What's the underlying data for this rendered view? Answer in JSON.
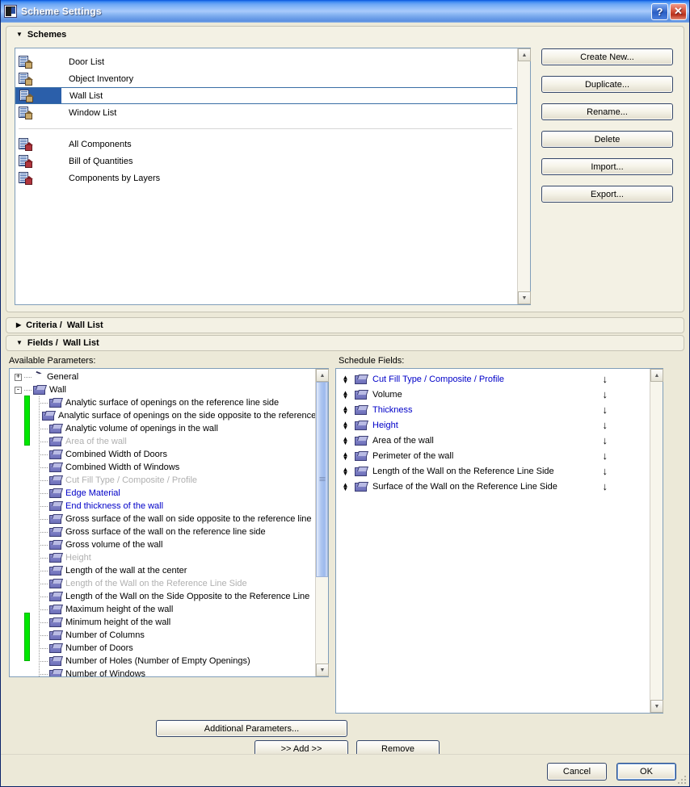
{
  "window": {
    "title": "Scheme Settings",
    "icon": "app-icon",
    "help_button": "?",
    "close_button": "✕"
  },
  "schemes_section": {
    "header": "Schemes",
    "expanded": true,
    "list": {
      "group_a": [
        {
          "label": "Door List",
          "icon": "scheme-icon",
          "selected": false
        },
        {
          "label": "Object Inventory",
          "icon": "scheme-icon",
          "selected": false
        },
        {
          "label": "Wall List",
          "icon": "scheme-icon",
          "selected": true
        },
        {
          "label": "Window List",
          "icon": "scheme-icon",
          "selected": false
        }
      ],
      "group_b": [
        {
          "label": "All Components",
          "icon": "component-scheme-icon",
          "selected": false
        },
        {
          "label": "Bill of Quantities",
          "icon": "component-scheme-icon",
          "selected": false
        },
        {
          "label": "Components by Layers",
          "icon": "component-scheme-icon",
          "selected": false
        }
      ]
    },
    "buttons": [
      {
        "label": "Create New...",
        "name": "create-new-button"
      },
      {
        "label": "Duplicate...",
        "name": "duplicate-button"
      },
      {
        "label": "Rename...",
        "name": "rename-button"
      },
      {
        "label": "Delete",
        "name": "delete-button"
      },
      {
        "label": "Import...",
        "name": "import-button"
      },
      {
        "label": "Export...",
        "name": "export-button"
      }
    ]
  },
  "criteria_section": {
    "header_prefix": "Criteria /",
    "header_suffix": "Wall List",
    "expanded": false
  },
  "fields_section": {
    "header_prefix": "Fields /",
    "header_suffix": "Wall List",
    "expanded": true,
    "available_label": "Available Parameters:",
    "schedule_label": "Schedule Fields:",
    "tree": [
      {
        "label": "General",
        "level": 0,
        "node": true,
        "expander": "+",
        "icon": "cursor-icon",
        "style": "normal"
      },
      {
        "label": "Wall",
        "level": 0,
        "node": true,
        "expander": "-",
        "icon": "folder-icon",
        "style": "normal"
      },
      {
        "label": "Analytic surface of openings on the reference line side",
        "level": 2,
        "icon": "folder-icon",
        "style": "normal"
      },
      {
        "label": "Analytic surface of openings on the side opposite to the reference line",
        "level": 2,
        "icon": "folder-icon",
        "style": "normal"
      },
      {
        "label": "Analytic volume of openings in the wall",
        "level": 2,
        "icon": "folder-icon",
        "style": "normal"
      },
      {
        "label": "Area of the wall",
        "level": 2,
        "icon": "folder-icon",
        "style": "gray"
      },
      {
        "label": "Combined Width of Doors",
        "level": 2,
        "icon": "folder-icon",
        "style": "normal"
      },
      {
        "label": "Combined Width of Windows",
        "level": 2,
        "icon": "folder-icon",
        "style": "normal"
      },
      {
        "label": "Cut Fill Type / Composite / Profile",
        "level": 2,
        "icon": "folder-icon",
        "style": "gray"
      },
      {
        "label": "Edge Material",
        "level": 2,
        "icon": "folder-icon",
        "style": "blue"
      },
      {
        "label": "End thickness of the wall",
        "level": 2,
        "icon": "folder-icon",
        "style": "blue"
      },
      {
        "label": "Gross surface of the wall on side opposite to the reference line",
        "level": 2,
        "icon": "folder-icon",
        "style": "normal"
      },
      {
        "label": "Gross surface of the wall on the reference line side",
        "level": 2,
        "icon": "folder-icon",
        "style": "normal"
      },
      {
        "label": "Gross volume of the wall",
        "level": 2,
        "icon": "folder-icon",
        "style": "normal"
      },
      {
        "label": "Height",
        "level": 2,
        "icon": "folder-icon",
        "style": "gray"
      },
      {
        "label": "Length of the wall at the center",
        "level": 2,
        "icon": "folder-icon",
        "style": "normal"
      },
      {
        "label": "Length of the Wall on the Reference Line Side",
        "level": 2,
        "icon": "folder-icon",
        "style": "gray"
      },
      {
        "label": "Length of the Wall on the Side Opposite to the Reference Line",
        "level": 2,
        "icon": "folder-icon",
        "style": "normal"
      },
      {
        "label": "Maximum height of the wall",
        "level": 2,
        "icon": "folder-icon",
        "style": "normal"
      },
      {
        "label": "Minimum height of the wall",
        "level": 2,
        "icon": "folder-icon",
        "style": "normal"
      },
      {
        "label": "Number of Columns",
        "level": 2,
        "icon": "folder-icon",
        "style": "normal"
      },
      {
        "label": "Number of Doors",
        "level": 2,
        "icon": "folder-icon",
        "style": "normal"
      },
      {
        "label": "Number of Holes (Number of Empty Openings)",
        "level": 2,
        "icon": "folder-icon",
        "style": "normal"
      },
      {
        "label": "Number of Windows",
        "level": 2,
        "icon": "folder-icon",
        "style": "normal"
      }
    ],
    "schedule_fields": [
      {
        "label": "Cut Fill Type / Composite / Profile",
        "style": "blue",
        "sort": "↓"
      },
      {
        "label": "Volume",
        "style": "normal",
        "sort": "↓"
      },
      {
        "label": "Thickness",
        "style": "blue",
        "sort": "↓"
      },
      {
        "label": "Height",
        "style": "blue",
        "sort": "↓"
      },
      {
        "label": "Area of the wall",
        "style": "normal",
        "sort": "↓"
      },
      {
        "label": "Perimeter of the wall",
        "style": "normal",
        "sort": "↓"
      },
      {
        "label": "Length of the Wall on the Reference Line Side",
        "style": "normal",
        "sort": "↓"
      },
      {
        "label": "Surface of the Wall on the Reference Line Side",
        "style": "normal",
        "sort": "↓"
      }
    ],
    "additional_parameters_button": "Additional Parameters...",
    "add_button": ">> Add >>",
    "remove_button": "Remove"
  },
  "footer": {
    "cancel": "Cancel",
    "ok": "OK"
  },
  "colors": {
    "highlight_green": "#00e800",
    "selection_blue": "#2b5faa",
    "link_blue": "#0000c8",
    "disabled_gray": "#b0b0b0",
    "dialog_bg": "#ece9d8",
    "title_blue": "#0855dd"
  },
  "scroll_arrows": {
    "up": "▲",
    "down": "▼"
  }
}
